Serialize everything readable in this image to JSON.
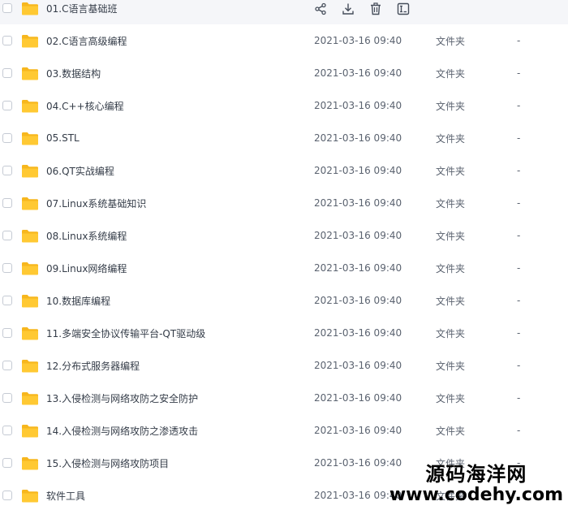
{
  "rows": [
    {
      "name": "01.C语言基础班",
      "date": "",
      "type": "",
      "size": ""
    },
    {
      "name": "02.C语言高级编程",
      "date": "2021-03-16 09:40",
      "type": "文件夹",
      "size": "-"
    },
    {
      "name": "03.数据结构",
      "date": "2021-03-16 09:40",
      "type": "文件夹",
      "size": "-"
    },
    {
      "name": "04.C++核心编程",
      "date": "2021-03-16 09:40",
      "type": "文件夹",
      "size": "-"
    },
    {
      "name": "05.STL",
      "date": "2021-03-16 09:40",
      "type": "文件夹",
      "size": "-"
    },
    {
      "name": "06.QT实战编程",
      "date": "2021-03-16 09:40",
      "type": "文件夹",
      "size": "-"
    },
    {
      "name": "07.Linux系统基础知识",
      "date": "2021-03-16 09:40",
      "type": "文件夹",
      "size": "-"
    },
    {
      "name": "08.Linux系统编程",
      "date": "2021-03-16 09:40",
      "type": "文件夹",
      "size": "-"
    },
    {
      "name": "09.Linux网络编程",
      "date": "2021-03-16 09:40",
      "type": "文件夹",
      "size": "-"
    },
    {
      "name": "10.数据库编程",
      "date": "2021-03-16 09:40",
      "type": "文件夹",
      "size": "-"
    },
    {
      "name": "11.多端安全协议传输平台-QT驱动级",
      "date": "2021-03-16 09:40",
      "type": "文件夹",
      "size": "-"
    },
    {
      "name": "12.分布式服务器编程",
      "date": "2021-03-16 09:40",
      "type": "文件夹",
      "size": "-"
    },
    {
      "name": "13.入侵检测与网络攻防之安全防护",
      "date": "2021-03-16 09:40",
      "type": "文件夹",
      "size": "-"
    },
    {
      "name": "14.入侵检测与网络攻防之渗透攻击",
      "date": "2021-03-16 09:40",
      "type": "文件夹",
      "size": "-"
    },
    {
      "name": "15.入侵检测与网络攻防项目",
      "date": "2021-03-16 09:40",
      "type": "文件夹",
      "size": "-"
    },
    {
      "name": "软件工具",
      "date": "2021-03-16 09:40",
      "type": "文件夹",
      "size": ""
    }
  ],
  "hover_actions": [
    "share-icon",
    "download-icon",
    "delete-icon",
    "rename-icon"
  ],
  "watermark": {
    "text": "源码海洋网",
    "url": "www.codehy.com"
  },
  "colors": {
    "folder": "#ffc933",
    "folder_dark": "#f7b71e",
    "hover_row": "#f5f6f9"
  }
}
